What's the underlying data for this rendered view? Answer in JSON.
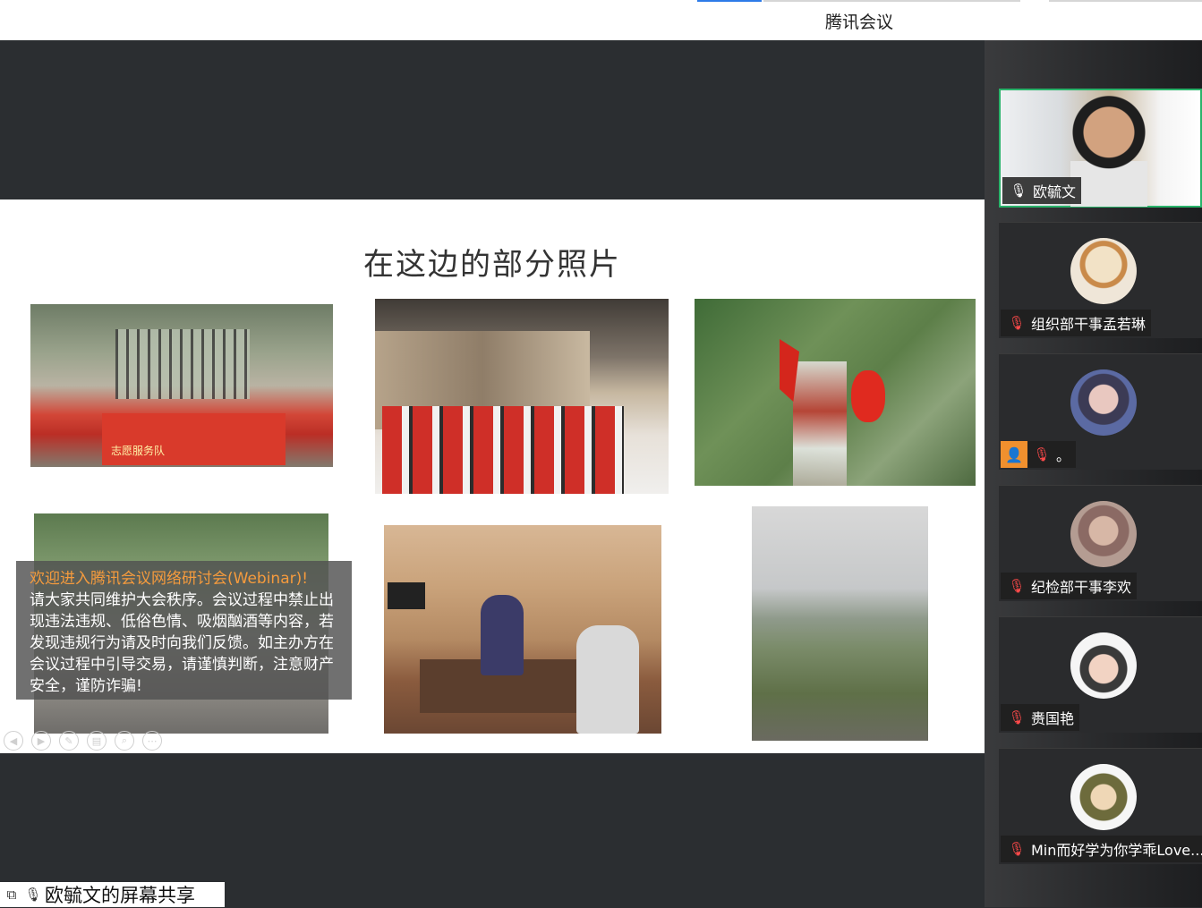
{
  "app": {
    "title": "腾讯会议"
  },
  "slide": {
    "title": "在这边的部分照片",
    "photo1_banner": "志愿服务队"
  },
  "notice": {
    "headline": "欢迎进入腾讯会议网络研讨会(Webinar)!",
    "body": "请大家共同维护大会秩序。会议过程中禁止出现违法违规、低俗色情、吸烟酗酒等内容，若发现违规行为请及时向我们反馈。如主办方在会议过程中引导交易，请谨慎判断，注意财产安全，谨防诈骗!"
  },
  "share": {
    "label": "欧毓文的屏幕共享"
  },
  "participants": [
    {
      "name": "欧毓文",
      "mic": "on"
    },
    {
      "name": "组织部干事孟若琳",
      "mic": "off"
    },
    {
      "name": "。",
      "mic": "off"
    },
    {
      "name": "纪检部干事李欢",
      "mic": "off"
    },
    {
      "name": "赉国艳",
      "mic": "off"
    },
    {
      "name": "Min而好学为你学乖Love...",
      "mic": "off"
    }
  ],
  "icons": {
    "mic_on": "microphone-icon",
    "mic_off": "microphone-muted-icon",
    "share": "screen-share-icon",
    "user": "user-icon"
  },
  "colors": {
    "accent": "#2d7be8",
    "active_speaker": "#29b36a",
    "notice_headline": "#f59b3d",
    "muted": "#ff4a4a"
  }
}
